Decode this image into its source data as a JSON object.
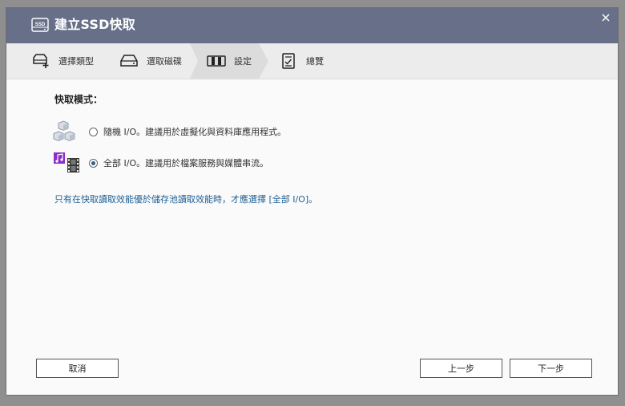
{
  "window": {
    "title": "建立SSD快取",
    "close_label": "×",
    "title_icon": "ssd-icon"
  },
  "steps": [
    {
      "label": "選擇類型",
      "icon": "drive-add-icon",
      "active": false
    },
    {
      "label": "選取磁碟",
      "icon": "drive-icon",
      "active": false
    },
    {
      "label": "設定",
      "icon": "settings-panel-icon",
      "active": true
    },
    {
      "label": "總覽",
      "icon": "checklist-icon",
      "active": false
    }
  ],
  "mode": {
    "label": "快取模式：",
    "options": [
      {
        "label": "隨機 I/O。建議用於虛擬化與資料庫應用程式。",
        "icon": "cubes-icon",
        "selected": false
      },
      {
        "label": "全部 I/O。建議用於檔案服務與媒體串流。",
        "icon": "media-icon",
        "selected": true
      }
    ]
  },
  "hint": "只有在快取讀取效能優於儲存池讀取效能時，才應選擇 [全部 I/O]。",
  "buttons": {
    "cancel": "取消",
    "back": "上一步",
    "next": "下一步"
  },
  "colors": {
    "titlebar": "#687089",
    "hint_text": "#1f5f94",
    "active_step": "#dcdcdc"
  }
}
